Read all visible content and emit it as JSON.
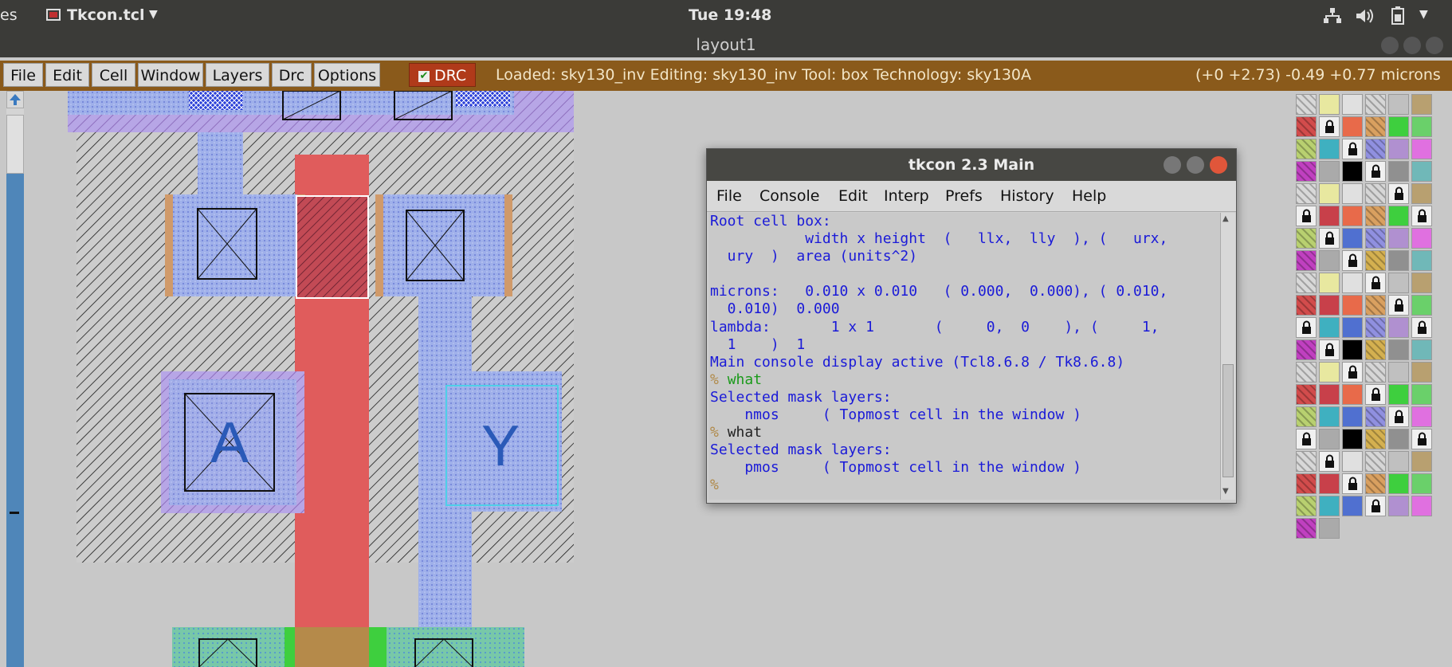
{
  "topbar": {
    "left_fragment": "es",
    "app_name": "Tkcon.tcl",
    "clock": "Tue 19:48"
  },
  "window": {
    "title": "layout1"
  },
  "menubar": {
    "menus": [
      "File",
      "Edit",
      "Cell",
      "Window",
      "Layers",
      "Drc",
      "Options"
    ],
    "drc_label": "DRC",
    "status_text": "Loaded: sky130_inv Editing: sky130_inv Tool: box  Technology: sky130A",
    "coords_text": "(+0 +2.73) -0.49 +0.77 microns"
  },
  "layout": {
    "pin_a": "A",
    "pin_y": "Y"
  },
  "tkcon": {
    "title": "tkcon 2.3 Main",
    "menus": [
      "File",
      "Console",
      "Edit",
      "Interp",
      "Prefs",
      "History",
      "Help"
    ],
    "lines": [
      {
        "text": "Root cell box:",
        "cls": ""
      },
      {
        "text": "           width x height  (   llx,  lly  ), (   urx,",
        "cls": ""
      },
      {
        "text": "  ury  )  area (units^2)",
        "cls": ""
      },
      {
        "text": "",
        "cls": ""
      },
      {
        "text": "microns:   0.010 x 0.010   ( 0.000,  0.000), ( 0.010,",
        "cls": ""
      },
      {
        "text": "  0.010)  0.000",
        "cls": ""
      },
      {
        "text": "lambda:       1 x 1       (     0,  0    ), (     1,",
        "cls": ""
      },
      {
        "text": "  1    )  1",
        "cls": ""
      },
      {
        "text": "Main console display active (Tcl8.6.8 / Tk8.6.8)",
        "cls": ""
      }
    ],
    "prompt": "%",
    "cmd1": "what",
    "sel_label_1": "Selected mask layers:",
    "sel_value_1": "    nmos     ( Topmost cell in the window )",
    "cmd2": "what",
    "sel_label_2": "Selected mask layers:",
    "sel_value_2": "    pmos     ( Topmost cell in the window )"
  },
  "colors": {
    "titlebar": "#3b3b38",
    "menubar": "#8a5a1b",
    "poly": "#e05c5c",
    "metal": "#a6b4ea",
    "diff_green": "#3ecf3e",
    "console_text": "#1a1ad8"
  }
}
